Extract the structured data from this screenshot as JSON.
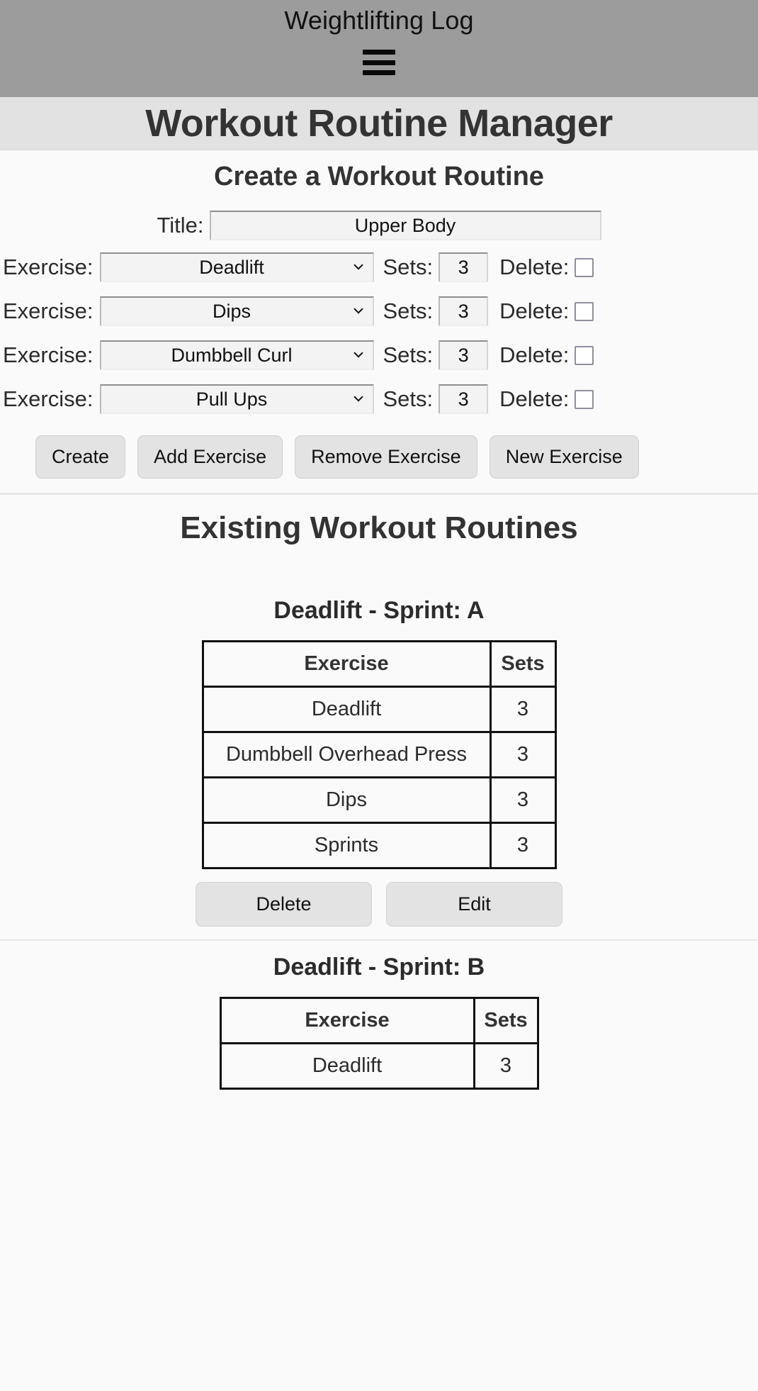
{
  "appbar": {
    "title": "Weightlifting Log",
    "menu_icon": "hamburger-menu-icon"
  },
  "page": {
    "title": "Workout Routine Manager"
  },
  "create_section": {
    "heading": "Create a Workout Routine",
    "title_label": "Title:",
    "title_value": "Upper Body",
    "title_placeholder": "",
    "exercise_label": "Exercise:",
    "sets_label": "Sets:",
    "delete_label": "Delete:",
    "rows": [
      {
        "exercise": "Deadlift",
        "sets": "3",
        "delete_checked": false
      },
      {
        "exercise": "Dips",
        "sets": "3",
        "delete_checked": false
      },
      {
        "exercise": "Dumbbell Curl",
        "sets": "3",
        "delete_checked": false
      },
      {
        "exercise": "Pull Ups",
        "sets": "3",
        "delete_checked": false
      }
    ],
    "buttons": [
      "Create",
      "Add Exercise",
      "Remove Exercise",
      "New Exercise"
    ]
  },
  "existing_section": {
    "heading": "Existing Workout Routines",
    "columns": [
      "Exercise",
      "Sets"
    ],
    "delete_button": "Delete",
    "edit_button": "Edit",
    "routines": [
      {
        "title": "Deadlift - Sprint: A",
        "rows": [
          {
            "exercise": "Deadlift",
            "sets": "3"
          },
          {
            "exercise": "Dumbbell Overhead Press",
            "sets": "3"
          },
          {
            "exercise": "Dips",
            "sets": "3"
          },
          {
            "exercise": "Sprints",
            "sets": "3"
          }
        ]
      },
      {
        "title": "Deadlift - Sprint: B",
        "rows": [
          {
            "exercise": "Deadlift",
            "sets": "3"
          }
        ]
      }
    ]
  },
  "colors": {
    "appbar_bg": "#9c9c9c",
    "title_bar_bg": "#e2e2e2",
    "page_bg": "#fafafa",
    "button_bg": "#e3e3e3",
    "table_border": "#111111"
  }
}
